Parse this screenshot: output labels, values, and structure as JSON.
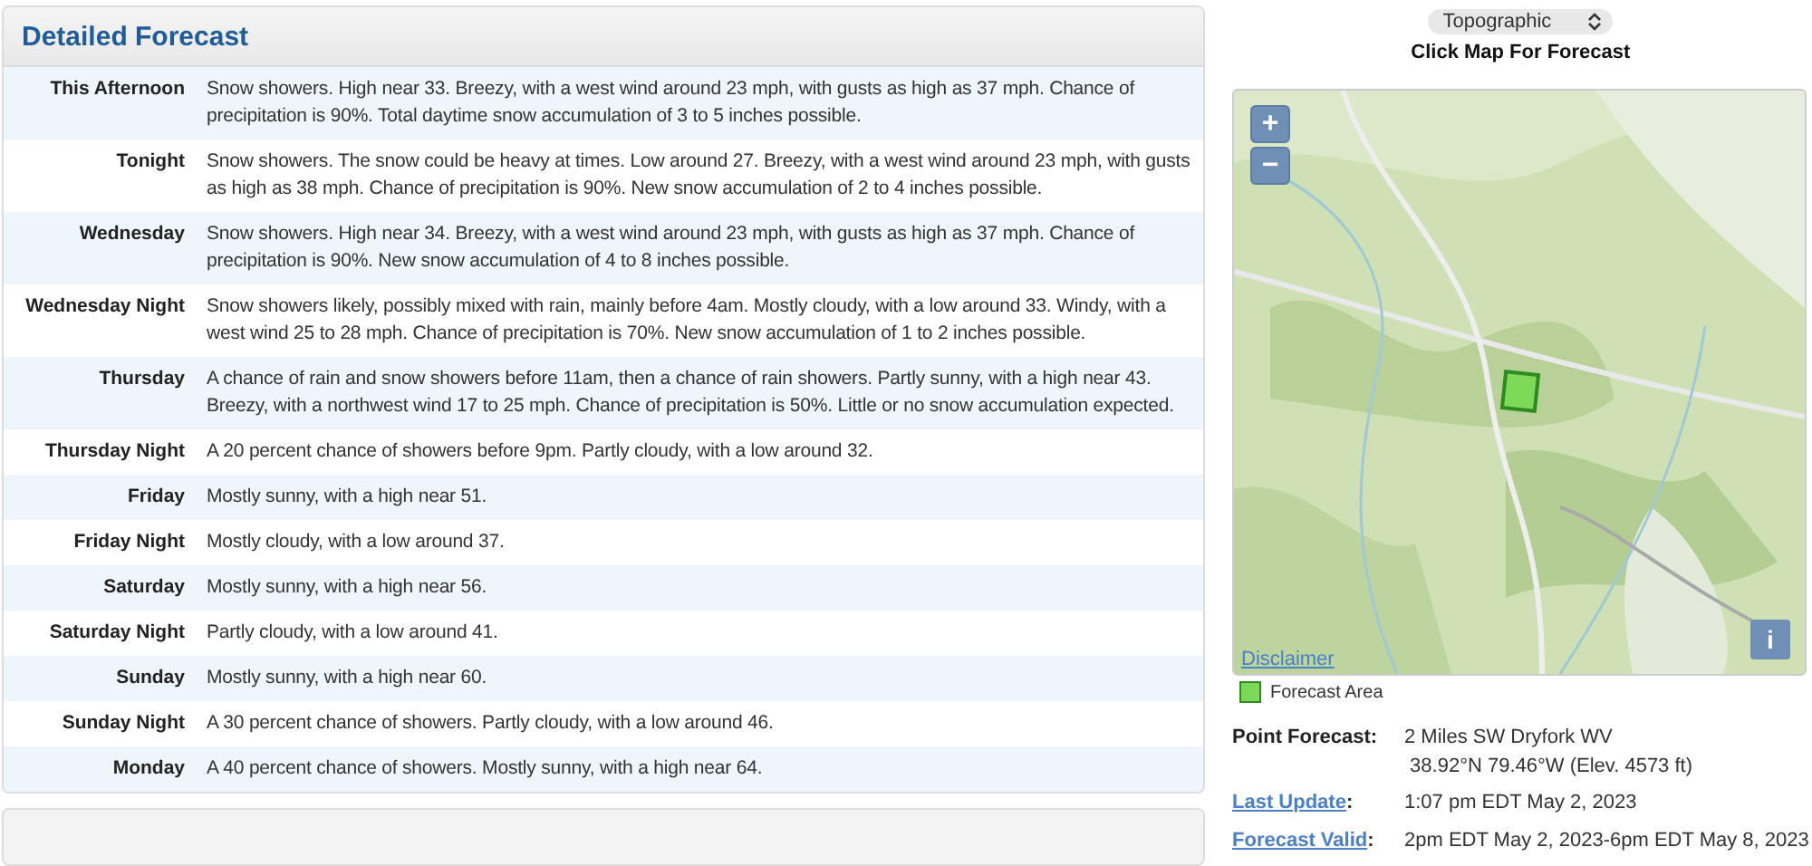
{
  "forecast": {
    "title": "Detailed Forecast",
    "periods": [
      {
        "name": "This Afternoon",
        "text": "Snow showers. High near 33. Breezy, with a west wind around 23 mph, with gusts as high as 37 mph. Chance of precipitation is 90%. Total daytime snow accumulation of 3 to 5 inches possible."
      },
      {
        "name": "Tonight",
        "text": "Snow showers. The snow could be heavy at times. Low around 27. Breezy, with a west wind around 23 mph, with gusts as high as 38 mph. Chance of precipitation is 90%. New snow accumulation of 2 to 4 inches possible."
      },
      {
        "name": "Wednesday",
        "text": "Snow showers. High near 34. Breezy, with a west wind around 23 mph, with gusts as high as 37 mph. Chance of precipitation is 90%. New snow accumulation of 4 to 8 inches possible."
      },
      {
        "name": "Wednesday Night",
        "text": "Snow showers likely, possibly mixed with rain, mainly before 4am. Mostly cloudy, with a low around 33. Windy, with a west wind 25 to 28 mph. Chance of precipitation is 70%. New snow accumulation of 1 to 2 inches possible."
      },
      {
        "name": "Thursday",
        "text": "A chance of rain and snow showers before 11am, then a chance of rain showers. Partly sunny, with a high near 43. Breezy, with a northwest wind 17 to 25 mph. Chance of precipitation is 50%. Little or no snow accumulation expected."
      },
      {
        "name": "Thursday Night",
        "text": "A 20 percent chance of showers before 9pm. Partly cloudy, with a low around 32."
      },
      {
        "name": "Friday",
        "text": "Mostly sunny, with a high near 51."
      },
      {
        "name": "Friday Night",
        "text": "Mostly cloudy, with a low around 37."
      },
      {
        "name": "Saturday",
        "text": "Mostly sunny, with a high near 56."
      },
      {
        "name": "Saturday Night",
        "text": "Partly cloudy, with a low around 41."
      },
      {
        "name": "Sunday",
        "text": "Mostly sunny, with a high near 60."
      },
      {
        "name": "Sunday Night",
        "text": "A 30 percent chance of showers. Partly cloudy, with a low around 46."
      },
      {
        "name": "Monday",
        "text": "A 40 percent chance of showers. Mostly sunny, with a high near 64."
      }
    ]
  },
  "map": {
    "layer_select": "Topographic",
    "prompt": "Click Map For Forecast",
    "zoom_in": "+",
    "zoom_out": "−",
    "info": "i",
    "disclaimer": "Disclaimer",
    "legend": "Forecast Area"
  },
  "details": [
    {
      "kind": "label",
      "label": "Point Forecast:",
      "values": [
        "2 Miles SW Dryfork WV",
        " 38.92°N 79.46°W (Elev. 4573 ft)"
      ]
    },
    {
      "kind": "link",
      "label": "Last Update",
      "suffix": ":",
      "values": [
        "1:07 pm EDT May 2, 2023"
      ]
    },
    {
      "kind": "link",
      "label": "Forecast Valid",
      "suffix": ":",
      "values": [
        "2pm EDT May 2, 2023-6pm EDT May 8, 2023"
      ]
    }
  ]
}
